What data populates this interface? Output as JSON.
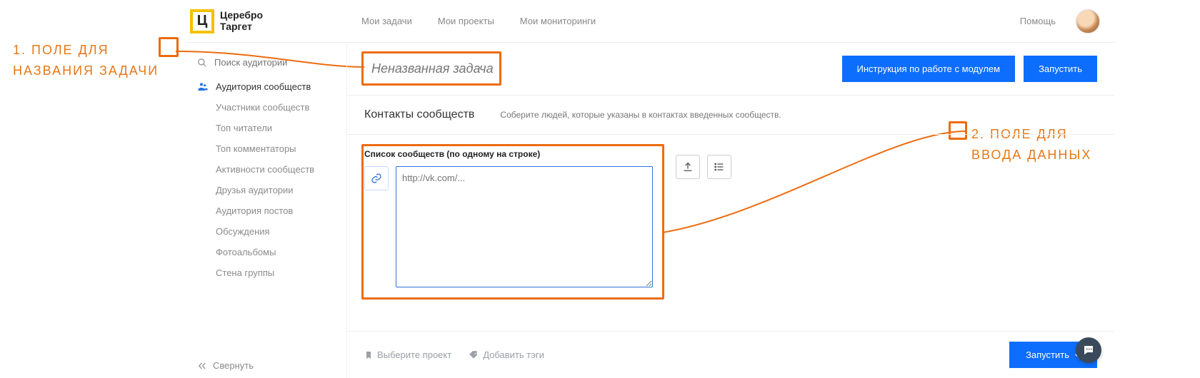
{
  "brand": {
    "mark": "Ц",
    "line1": "Церебро",
    "line2": "Таргет"
  },
  "topnav": {
    "tasks": "Мои задачи",
    "projects": "Мои проекты",
    "monitorings": "Мои мониторинги",
    "help": "Помощь"
  },
  "sidebar": {
    "search_placeholder": "Поиск аудитории",
    "group_title": "Аудитория сообществ",
    "items": [
      "Участники сообществ",
      "Топ читатели",
      "Топ комментаторы",
      "Активности сообществ",
      "Друзья аудитории",
      "Аудитория постов",
      "Обсуждения",
      "Фотоальбомы",
      "Стена группы"
    ],
    "collapse": "Свернуть"
  },
  "task": {
    "name_placeholder": "Неназванная задача",
    "instruction_btn": "Инструкция по работе с модулем",
    "run_btn": "Запустить"
  },
  "content": {
    "title": "Контакты сообществ",
    "desc": "Соберите людей, которые указаны в контактах введенных сообществ.",
    "list_label": "Список сообществ (по одному на строке)",
    "textarea_placeholder": "http://vk.com/..."
  },
  "footer": {
    "select_project": "Выберите проект",
    "add_tags": "Добавить тэги",
    "run_btn": "Запустить"
  },
  "annotations": {
    "a1_line1": "1. Поле для",
    "a1_line2": "названия задачи",
    "a2_line1": "2. Поле для",
    "a2_line2": "ввода данных"
  }
}
